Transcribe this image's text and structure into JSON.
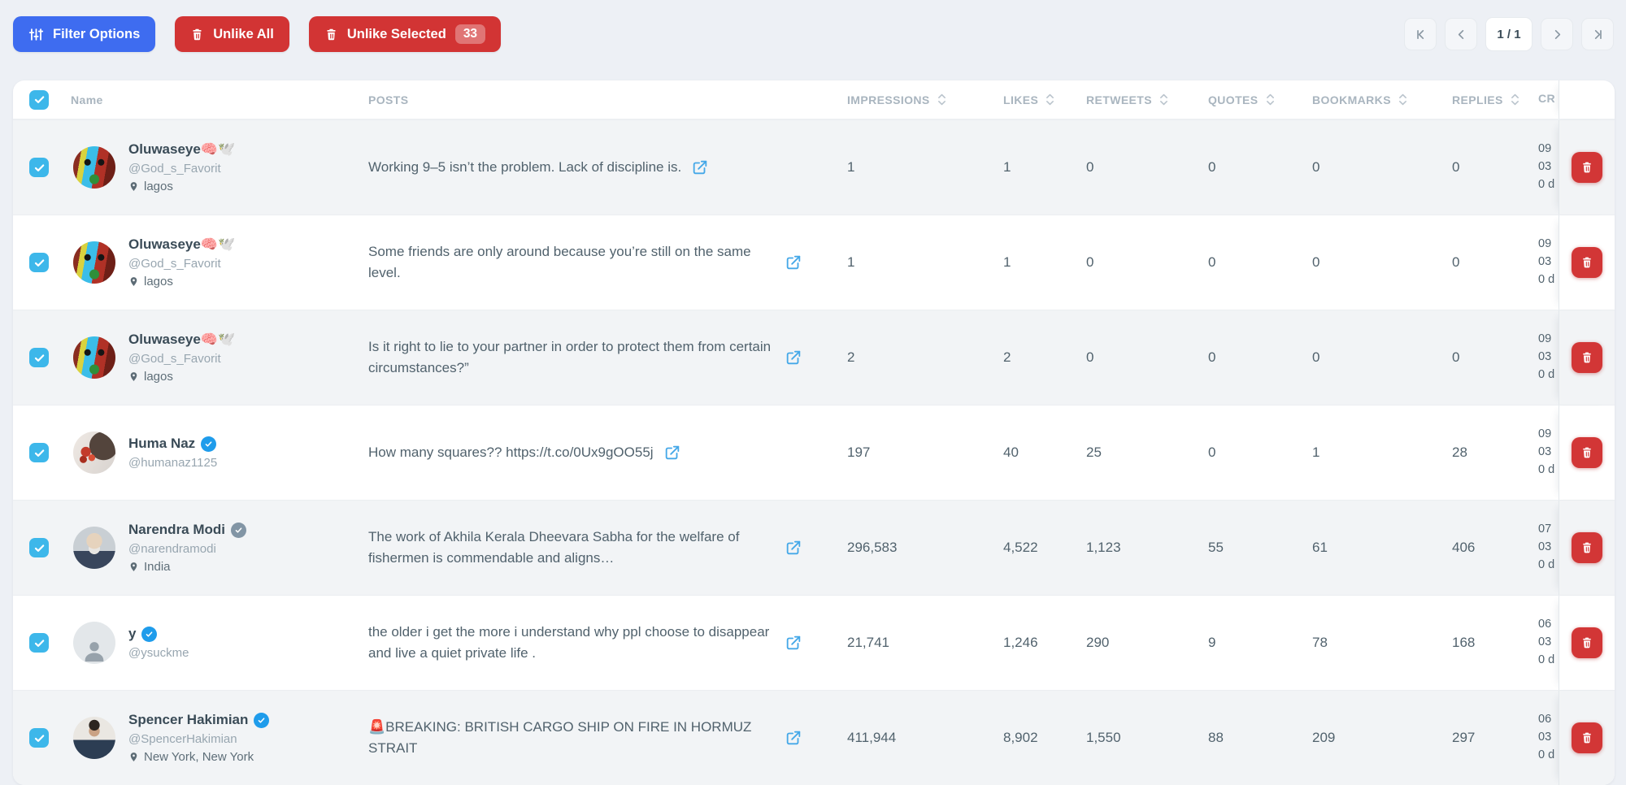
{
  "toolbar": {
    "filter_button": "Filter Options",
    "unlike_all_button": "Unlike All",
    "unlike_selected_button": "Unlike Selected",
    "unlike_selected_count": "33"
  },
  "pagination": {
    "current_page_label": "1 / 1"
  },
  "colors": {
    "accent_blue": "#3e6cf0",
    "danger_red": "#d23434",
    "checkbox_blue": "#3db7ea",
    "verified_blue": "#1f9ceb",
    "verified_gray": "#8295a5",
    "link_blue": "#45a8e8",
    "page_background": "#edf0f5",
    "stripe_gray": "#f2f4f6"
  },
  "table": {
    "columns": {
      "name": "Name",
      "posts": "POSTS",
      "impressions": "IMPRESSIONS",
      "likes": "LIKES",
      "retweets": "RETWEETS",
      "quotes": "QUOTES",
      "bookmarks": "BOOKMARKS",
      "replies": "REPLIES",
      "created": "CR"
    },
    "rows": [
      {
        "name": "Oluwaseye🧠🕊️",
        "badge": null,
        "handle": "@God_s_Favorit",
        "location": "lagos",
        "avatar": "painted-art",
        "post": "Working 9–5 isn’t the problem. Lack of discipline is.",
        "metrics": {
          "impressions": "1",
          "likes": "1",
          "retweets": "0",
          "quotes": "0",
          "bookmarks": "0",
          "replies": "0"
        },
        "created": [
          "09",
          "03",
          "0 d"
        ]
      },
      {
        "name": "Oluwaseye🧠🕊️",
        "badge": null,
        "handle": "@God_s_Favorit",
        "location": "lagos",
        "avatar": "painted-art",
        "post": "Some friends are only around because you’re still on the same level.",
        "metrics": {
          "impressions": "1",
          "likes": "1",
          "retweets": "0",
          "quotes": "0",
          "bookmarks": "0",
          "replies": "0"
        },
        "created": [
          "09",
          "03",
          "0 d"
        ]
      },
      {
        "name": "Oluwaseye🧠🕊️",
        "badge": null,
        "handle": "@God_s_Favorit",
        "location": "lagos",
        "avatar": "painted-art",
        "post": "Is it right to lie to your partner in order to protect them from certain circumstances?”",
        "metrics": {
          "impressions": "2",
          "likes": "2",
          "retweets": "0",
          "quotes": "0",
          "bookmarks": "0",
          "replies": "0"
        },
        "created": [
          "09",
          "03",
          "0 d"
        ]
      },
      {
        "name": "Huma Naz",
        "badge": "blue",
        "handle": "@humanaz1125",
        "location": null,
        "avatar": "woman-flowers",
        "post": "How many squares?? https://t.co/0Ux9gOO55j",
        "metrics": {
          "impressions": "197",
          "likes": "40",
          "retweets": "25",
          "quotes": "0",
          "bookmarks": "1",
          "replies": "28"
        },
        "created": [
          "09",
          "03",
          "0 d"
        ]
      },
      {
        "name": "Narendra Modi",
        "badge": "gray",
        "handle": "@narendramodi",
        "location": "India",
        "avatar": "modi",
        "post": "The work of Akhila Kerala Dheevara Sabha for the welfare of fishermen is commendable and aligns…",
        "metrics": {
          "impressions": "296,583",
          "likes": "4,522",
          "retweets": "1,123",
          "quotes": "55",
          "bookmarks": "61",
          "replies": "406"
        },
        "created": [
          "07",
          "03",
          "0 d"
        ]
      },
      {
        "name": "y",
        "badge": "blue",
        "handle": "@ysuckme",
        "location": null,
        "avatar": "default-person",
        "post": "the older i get the more i understand why ppl choose to disappear and live a quiet private life .",
        "metrics": {
          "impressions": "21,741",
          "likes": "1,246",
          "retweets": "290",
          "quotes": "9",
          "bookmarks": "78",
          "replies": "168"
        },
        "created": [
          "06",
          "03",
          "0 d"
        ]
      },
      {
        "name": "Spencer Hakimian",
        "badge": "blue",
        "handle": "@SpencerHakimian",
        "location": "New York, New York",
        "avatar": "man-suit",
        "post": "🚨BREAKING: BRITISH CARGO SHIP ON FIRE IN HORMUZ STRAIT",
        "metrics": {
          "impressions": "411,944",
          "likes": "8,902",
          "retweets": "1,550",
          "quotes": "88",
          "bookmarks": "209",
          "replies": "297"
        },
        "created": [
          "06",
          "03",
          "0 d"
        ]
      }
    ]
  }
}
